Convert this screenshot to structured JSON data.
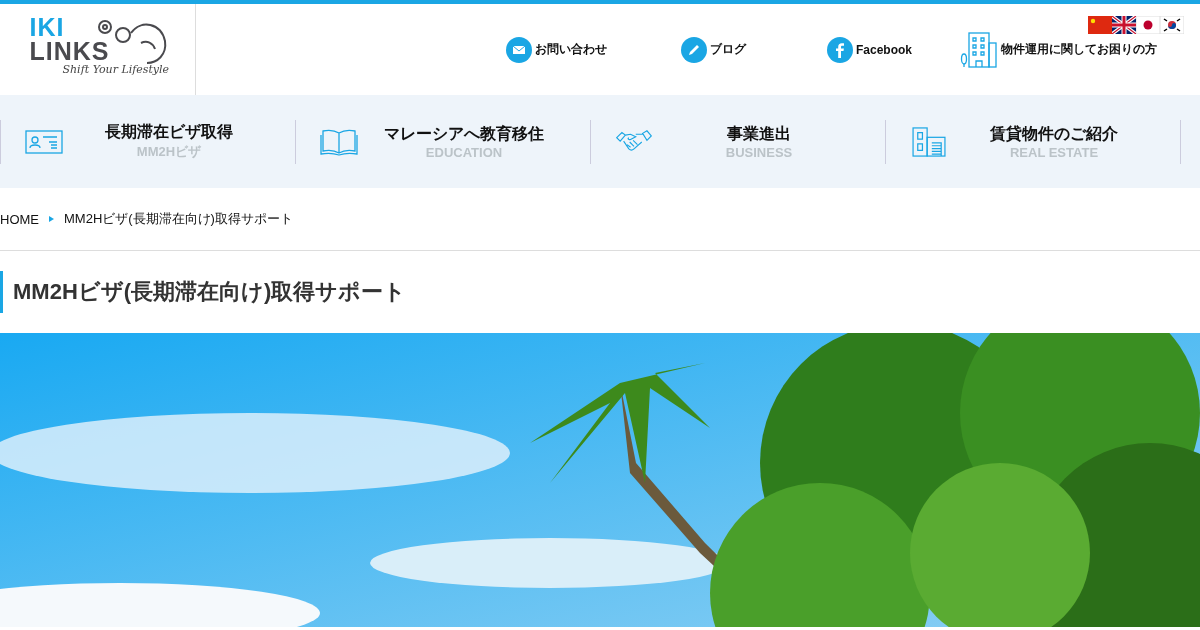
{
  "logo": {
    "top": "IKI",
    "bottom": "LINKS",
    "tagline": "Shift Your Lifestyle"
  },
  "header_links": [
    {
      "kind": "mail",
      "label": "お問い合わせ"
    },
    {
      "kind": "pencil",
      "label": "ブログ"
    },
    {
      "kind": "facebook",
      "label": "Facebook"
    },
    {
      "kind": "building",
      "label": "物件運用に関してお困りの方"
    }
  ],
  "languages": [
    {
      "kind": "cn"
    },
    {
      "kind": "uk"
    },
    {
      "kind": "jp"
    },
    {
      "kind": "kr"
    }
  ],
  "nav": [
    {
      "kind": "card",
      "label": "長期滞在ビザ取得",
      "sub": "MM2Hビザ"
    },
    {
      "kind": "book",
      "label": "マレーシアへ教育移住",
      "sub": "EDUCATION"
    },
    {
      "kind": "handshake",
      "label": "事業進出",
      "sub": "BUSINESS"
    },
    {
      "kind": "house",
      "label": "賃貸物件のご紹介",
      "sub": "REAL ESTATE"
    }
  ],
  "breadcrumb": [
    "HOME",
    "MM2Hビザ(長期滞在向け)取得サポート"
  ],
  "page_title": "MM2Hビザ(長期滞在向け)取得サポート"
}
